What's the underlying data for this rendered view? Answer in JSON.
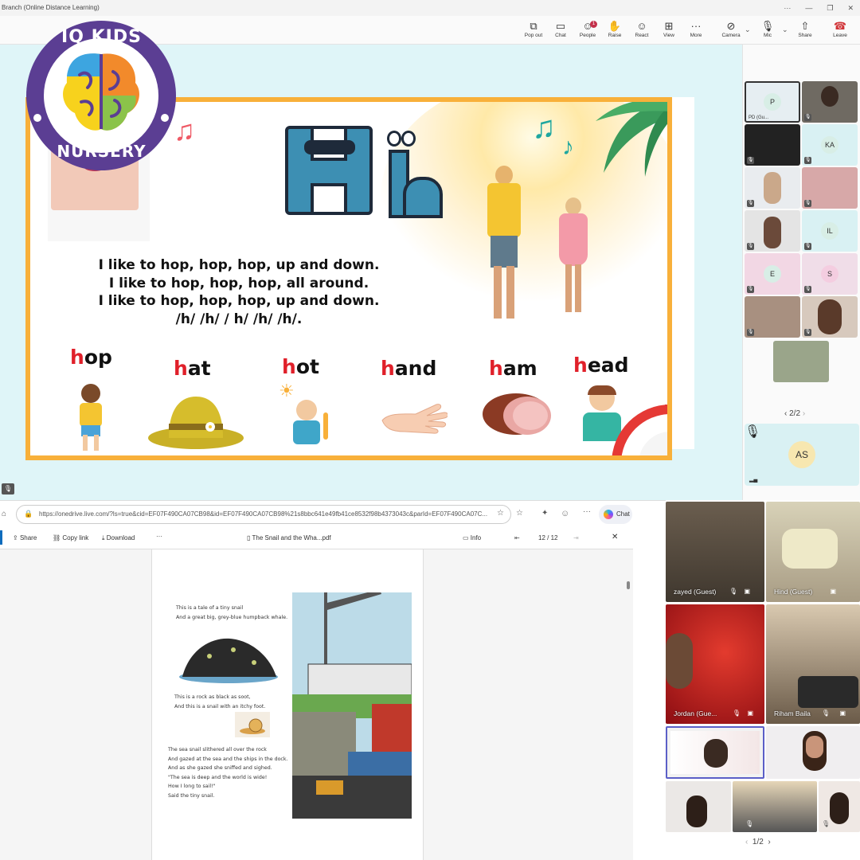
{
  "window": {
    "title": "Branch (Online Distance Learning)",
    "controls": [
      "···",
      "—",
      "❐",
      "✕"
    ]
  },
  "toolbar": {
    "items": [
      {
        "label": "Pop out",
        "icon": "pop-out-icon"
      },
      {
        "label": "Chat",
        "icon": "chat-icon"
      },
      {
        "label": "People",
        "icon": "people-icon",
        "badge": "1"
      },
      {
        "label": "Raise",
        "icon": "raise-hand-icon"
      },
      {
        "label": "React",
        "icon": "react-icon"
      },
      {
        "label": "View",
        "icon": "view-icon"
      },
      {
        "label": "More",
        "icon": "more-icon"
      },
      {
        "label": "Camera",
        "icon": "camera-off-icon"
      },
      {
        "label": "Mic",
        "icon": "mic-off-icon"
      },
      {
        "label": "Share",
        "icon": "share-icon"
      },
      {
        "label": "Leave",
        "icon": "leave-icon"
      }
    ]
  },
  "logo": {
    "top": "IQ KIDS",
    "bottom": "NURSERY"
  },
  "slide": {
    "rhyme": [
      "I like to hop, hop, hop, up and down.",
      "I like to hop, hop, hop, all around.",
      "I like to hop, hop, hop, up and down.",
      "/h/ /h/ / h/ /h/ /h/."
    ],
    "words": [
      {
        "first": "h",
        "rest": "op"
      },
      {
        "first": "h",
        "rest": "at"
      },
      {
        "first": "h",
        "rest": "ot"
      },
      {
        "first": "h",
        "rest": "and"
      },
      {
        "first": "h",
        "rest": "am"
      },
      {
        "first": "h",
        "rest": "ead"
      }
    ]
  },
  "participants": {
    "tiles": [
      {
        "initials": "P",
        "label": "PD (Gu..."
      },
      {
        "initials": "KA"
      },
      {
        "initials": "IL"
      },
      {
        "initials": "E"
      },
      {
        "initials": "S"
      }
    ],
    "pager": "2/2",
    "self": {
      "initials": "AS"
    }
  },
  "browser": {
    "url": "https://onedrive.live.com/?ls=true&cid=EF07F490CA07CB98&id=EF07F490CA07CB98%21s8bbc641e49fb41ce8532f98b4373043c&parId=EF07F490CA07C...",
    "chat_label": "Chat",
    "share_label": "Share",
    "copy_link_label": "Copy link",
    "download_label": "Download",
    "more_label": "···",
    "file_name": "The Snail and the Wha...pdf",
    "info_label": "Info",
    "page_indicator": "12 / 12",
    "close_label": "✕"
  },
  "pdf": {
    "stanza1": [
      "This is a tale of a tiny snail",
      "And a great big, grey-blue humpback whale."
    ],
    "stanza2": [
      "This is a rock as black as soot,",
      "And this is a snail with an itchy foot."
    ],
    "stanza3": [
      "The sea snail slithered all over the rock",
      "And gazed at the sea and the ships in the dock.",
      "And as she gazed she sniffed and sighed.",
      "\"The sea is deep and the world is wide!",
      "How I long to sail!\"",
      "Said the tiny snail."
    ]
  },
  "video": {
    "names": [
      "zayed (Guest)",
      "Hind (Guest)",
      "Jordan (Gue...",
      "Riham Baila"
    ],
    "pager": "1/2"
  }
}
